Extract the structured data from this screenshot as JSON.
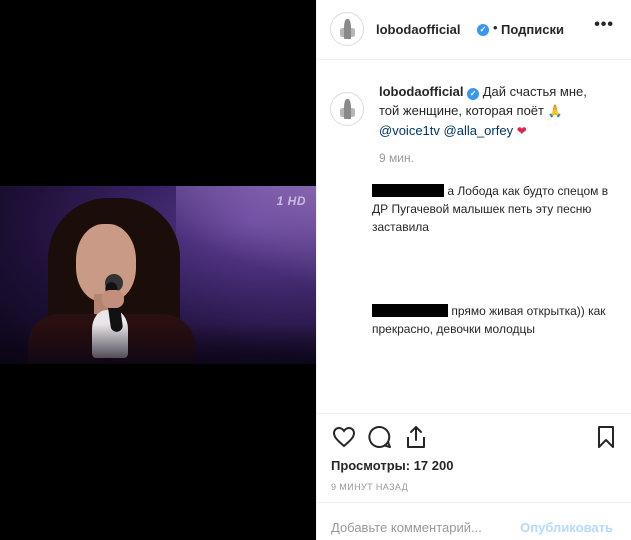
{
  "post": {
    "username": "lobodaofficial",
    "follow_label": "Подписки",
    "separator": "•",
    "more_label": "•••"
  },
  "video": {
    "channel_logo": "1 HD"
  },
  "caption": {
    "username": "lobodaofficial",
    "text_part1": "Дай счастья мне, той женщине, которая поёт",
    "mention1": "@voice1tv",
    "mention2": "@alla_orfey",
    "emoji1": "🙏",
    "emoji2": "❤",
    "time": "9 мин."
  },
  "comments": [
    {
      "author": "[redacted]",
      "text": "а Лобода как будто спецом в ДР Пугачевой малышек петь эту песню заставила"
    },
    {
      "author": "[redacted]",
      "text": "прямо живая открытка)) как прекрасно, девочки молодцы"
    }
  ],
  "actions": {
    "icons": [
      "heart-icon",
      "comment-icon",
      "share-icon",
      "bookmark-icon"
    ]
  },
  "stats": {
    "views": "Просмотры: 17 200",
    "ago": "9 МИНУТ НАЗАД"
  },
  "composer": {
    "placeholder": "Добавьте комментарий...",
    "publish_label": "Опубликовать"
  },
  "colors": {
    "verified": "#3897f0",
    "heart": "#e0234e",
    "publish_disabled": "#b3dbff",
    "muted": "#999999"
  }
}
